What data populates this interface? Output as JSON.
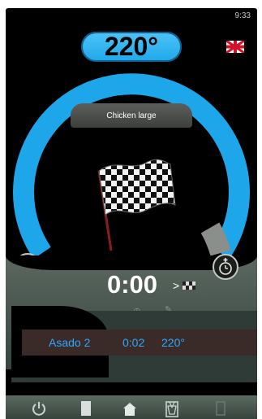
{
  "status": {
    "clock": "9:33"
  },
  "temperature": {
    "value": "220°"
  },
  "language": {
    "flag_icon": "uk-flag-icon"
  },
  "program": {
    "name": "Chicken large"
  },
  "progress": {
    "fraction_complete": 0.9
  },
  "timer": {
    "time": "0:00",
    "finish_symbol": ">"
  },
  "steps": [
    {
      "name": "Asado 2",
      "time": "0:02",
      "temp": "220°"
    }
  ],
  "colors": {
    "accent": "#1da8ea",
    "step_text": "#2ea8ff",
    "panel": "#4a5a52"
  },
  "nav": {
    "items": [
      {
        "icon": "power-icon"
      },
      {
        "icon": "book-icon"
      },
      {
        "icon": "home-icon"
      },
      {
        "icon": "basket-icon"
      },
      {
        "icon": "placeholder-icon"
      }
    ]
  }
}
